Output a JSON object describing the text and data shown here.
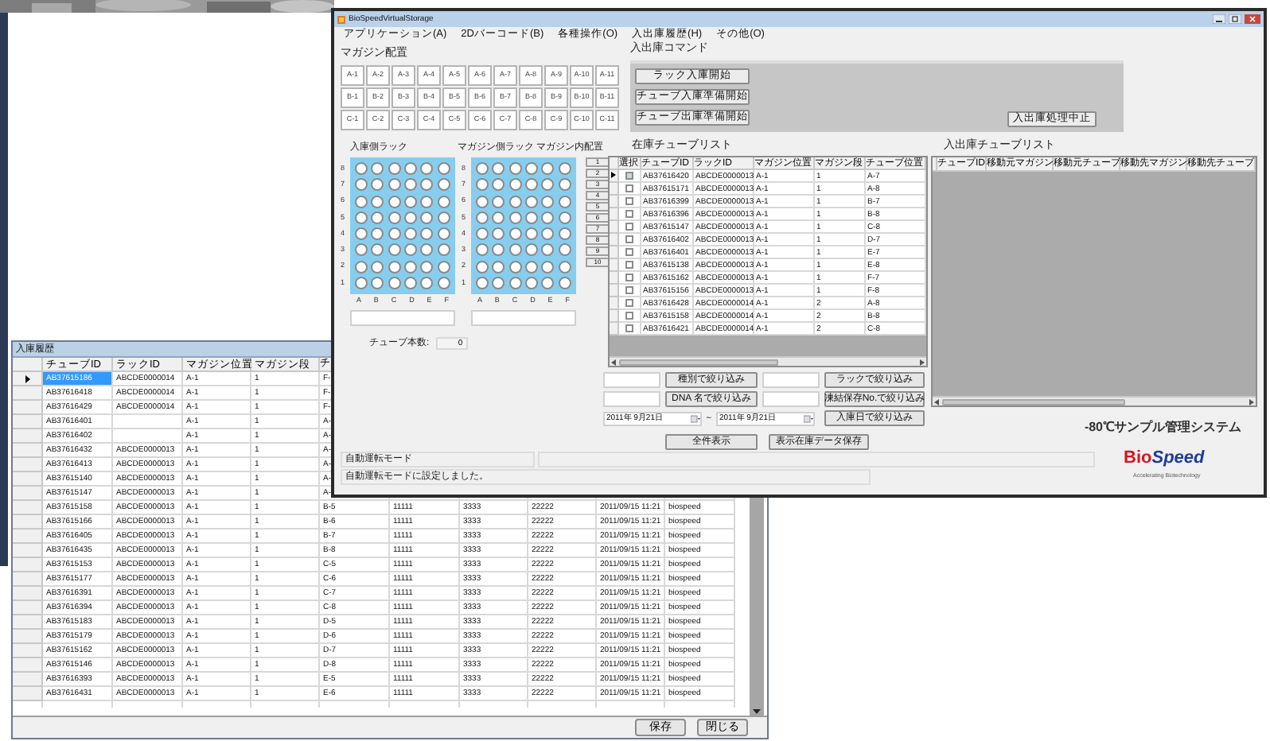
{
  "main_window": {
    "title": "BioSpeedVirtualStorage",
    "menu": [
      "アプリケーション(A)",
      "2Dバーコード(B)",
      "各種操作(O)",
      "入出庫履歴(H)",
      "その他(O)"
    ],
    "magazine_layout": {
      "label": "マガジン配置",
      "rows": [
        [
          "A-1",
          "A-2",
          "A-3",
          "A-4",
          "A-5",
          "A-6",
          "A-7",
          "A-8",
          "A-9",
          "A-10",
          "A-11"
        ],
        [
          "B-1",
          "B-2",
          "B-3",
          "B-4",
          "B-5",
          "B-6",
          "B-7",
          "B-8",
          "B-9",
          "B-10",
          "B-11"
        ],
        [
          "C-1",
          "C-2",
          "C-3",
          "C-4",
          "C-5",
          "C-6",
          "C-7",
          "C-8",
          "C-9",
          "C-10",
          "C-11"
        ]
      ]
    },
    "commands": {
      "label": "入出庫コマンド",
      "buttons": [
        "ラック入庫開始",
        "チューブ入庫準備開始",
        "チューブ出庫準備開始"
      ],
      "stop_button": "入出庫処理中止"
    },
    "racks": [
      {
        "label": "入庫側ラック",
        "row_labels": [
          "8",
          "7",
          "6",
          "5",
          "4",
          "3",
          "2",
          "1"
        ],
        "column_labels": [
          "A",
          "B",
          "C",
          "D",
          "E",
          "F"
        ]
      },
      {
        "label": "マガジン側ラック",
        "row_labels": [
          "8",
          "7",
          "6",
          "5",
          "4",
          "3",
          "2",
          "1"
        ],
        "column_labels": [
          "A",
          "B",
          "C",
          "D",
          "E",
          "F"
        ]
      }
    ],
    "magazine_positions": {
      "label": "マガジン内配置",
      "buttons": [
        "1",
        "2",
        "3",
        "4",
        "5",
        "6",
        "7",
        "8",
        "9",
        "10"
      ]
    },
    "tube_count": {
      "label": "チューブ本数:",
      "value": "0"
    },
    "stock_list": {
      "label": "在庫チューブリスト",
      "select_column": "選択",
      "columns": [
        "チューブID",
        "ラックID",
        "マガジン位置",
        "マガジン段",
        "チューブ位置"
      ],
      "rows": [
        {
          "selected": true,
          "checked": false,
          "cells": [
            "AB37616420",
            "ABCDE0000013",
            "A-1",
            "1",
            "A-7"
          ]
        },
        {
          "selected": false,
          "checked": false,
          "cells": [
            "AB37615171",
            "ABCDE0000013",
            "A-1",
            "1",
            "A-8"
          ]
        },
        {
          "selected": false,
          "checked": false,
          "cells": [
            "AB37616399",
            "ABCDE0000013",
            "A-1",
            "1",
            "B-7"
          ]
        },
        {
          "selected": false,
          "checked": false,
          "cells": [
            "AB37616396",
            "ABCDE0000013",
            "A-1",
            "1",
            "B-8"
          ]
        },
        {
          "selected": false,
          "checked": false,
          "cells": [
            "AB37615147",
            "ABCDE0000013",
            "A-1",
            "1",
            "C-8"
          ]
        },
        {
          "selected": false,
          "checked": false,
          "cells": [
            "AB37616402",
            "ABCDE0000013",
            "A-1",
            "1",
            "D-7"
          ]
        },
        {
          "selected": false,
          "checked": false,
          "cells": [
            "AB37616401",
            "ABCDE0000013",
            "A-1",
            "1",
            "E-7"
          ]
        },
        {
          "selected": false,
          "checked": false,
          "cells": [
            "AB37615138",
            "ABCDE0000013",
            "A-1",
            "1",
            "E-8"
          ]
        },
        {
          "selected": false,
          "checked": false,
          "cells": [
            "AB37615162",
            "ABCDE0000013",
            "A-1",
            "1",
            "F-7"
          ]
        },
        {
          "selected": false,
          "checked": false,
          "cells": [
            "AB37615156",
            "ABCDE0000013",
            "A-1",
            "1",
            "F-8"
          ]
        },
        {
          "selected": false,
          "checked": false,
          "cells": [
            "AB37616428",
            "ABCDE0000014",
            "A-1",
            "2",
            "A-8"
          ]
        },
        {
          "selected": false,
          "checked": false,
          "cells": [
            "AB37615158",
            "ABCDE0000014",
            "A-1",
            "2",
            "B-8"
          ]
        },
        {
          "selected": false,
          "checked": false,
          "cells": [
            "AB37616421",
            "ABCDE0000014",
            "A-1",
            "2",
            "C-8"
          ]
        }
      ]
    },
    "filters": {
      "type_button": "種別で絞り込み",
      "rack_button": "ラックで絞り込み",
      "dna_button": "DNA 名で絞り込み",
      "storage_button": "凍結保存No.で絞り込み",
      "date_from": "2011年 9月21日",
      "date_separator": "～",
      "date_to": "2011年 9月21日",
      "date_button": "入庫日で絞り込み",
      "show_all_button": "全件表示",
      "save_button": "表示在庫データ保存"
    },
    "transfer_list": {
      "label": "入出庫チューブリスト",
      "columns": [
        "チューブID",
        "移動元マガジン",
        "移動元チューブ",
        "移動先マガジン",
        "移動先チューブ"
      ]
    },
    "system_name": "-80℃サンプル管理システム",
    "logo": [
      "Bio",
      "Speed"
    ],
    "tagline": "Accelerating Biotechnology",
    "status": {
      "mode": "自動運転モード",
      "message": "自動運転モードに設定しました。"
    }
  },
  "history_window": {
    "title": "入庫履歴",
    "columns": [
      "チューブID",
      "ラックID",
      "マガジン位置",
      "マガジン段",
      "チ"
    ],
    "rows": [
      {
        "selected": true,
        "tube_id": "AB37615186",
        "rack_id": "ABCDE0000014",
        "magazine_position": "A-1",
        "magazine_stage": "1",
        "tube_position": "F-"
      },
      {
        "selected": false,
        "tube_id": "AB37616418",
        "rack_id": "ABCDE0000014",
        "magazine_position": "A-1",
        "magazine_stage": "1",
        "tube_position": "F-"
      },
      {
        "selected": false,
        "tube_id": "AB37616429",
        "rack_id": "ABCDE0000014",
        "magazine_position": "A-1",
        "magazine_stage": "1",
        "tube_position": "F-"
      },
      {
        "selected": false,
        "tube_id": "AB37616401",
        "magazine_position": "A-1",
        "magazine_stage": "1",
        "tube_position": "A-"
      },
      {
        "selected": false,
        "tube_id": "AB37616402",
        "magazine_position": "A-1",
        "magazine_stage": "1",
        "tube_position": "A-"
      },
      {
        "selected": false,
        "tube_id": "AB37616432",
        "rack_id": "ABCDE0000013",
        "magazine_position": "A-1",
        "magazine_stage": "1",
        "tube_position": "A-"
      },
      {
        "selected": false,
        "tube_id": "AB37616413",
        "rack_id": "ABCDE0000013",
        "magazine_position": "A-1",
        "magazine_stage": "1",
        "tube_position": "A-"
      },
      {
        "selected": false,
        "tube_id": "AB37615140",
        "rack_id": "ABCDE0000013",
        "magazine_position": "A-1",
        "magazine_stage": "1",
        "tube_position": "A-"
      },
      {
        "selected": false,
        "tube_id": "AB37615147",
        "rack_id": "ABCDE0000013",
        "magazine_position": "A-1",
        "magazine_stage": "1",
        "tube_position": "A-"
      },
      {
        "selected": false,
        "tube_id": "AB37615158",
        "rack_id": "ABCDE0000013",
        "magazine_position": "A-1",
        "magazine_stage": "1",
        "tube_position": "B-5",
        "column_6": "11111",
        "column_7": "3333",
        "column_8": "22222",
        "column_9": "2011/09/15 11:21",
        "column_10": "biospeed"
      },
      {
        "selected": false,
        "tube_id": "AB37615166",
        "rack_id": "ABCDE0000013",
        "magazine_position": "A-1",
        "magazine_stage": "1",
        "tube_position": "B-6",
        "column_6": "11111",
        "column_7": "3333",
        "column_8": "22222",
        "column_9": "2011/09/15 11:21",
        "column_10": "biospeed"
      },
      {
        "selected": false,
        "tube_id": "AB37616405",
        "rack_id": "ABCDE0000013",
        "magazine_position": "A-1",
        "magazine_stage": "1",
        "tube_position": "B-7",
        "column_6": "11111",
        "column_7": "3333",
        "column_8": "22222",
        "column_9": "2011/09/15 11:21",
        "column_10": "biospeed"
      },
      {
        "selected": false,
        "tube_id": "AB37616435",
        "rack_id": "ABCDE0000013",
        "magazine_position": "A-1",
        "magazine_stage": "1",
        "tube_position": "B-8",
        "column_6": "11111",
        "column_7": "3333",
        "column_8": "22222",
        "column_9": "2011/09/15 11:21",
        "column_10": "biospeed"
      },
      {
        "selected": false,
        "tube_id": "AB37615153",
        "rack_id": "ABCDE0000013",
        "magazine_position": "A-1",
        "magazine_stage": "1",
        "tube_position": "C-5",
        "column_6": "11111",
        "column_7": "3333",
        "column_8": "22222",
        "column_9": "2011/09/15 11:21",
        "column_10": "biospeed"
      },
      {
        "selected": false,
        "tube_id": "AB37615177",
        "rack_id": "ABCDE0000013",
        "magazine_position": "A-1",
        "magazine_stage": "1",
        "tube_position": "C-6",
        "column_6": "11111",
        "column_7": "3333",
        "column_8": "22222",
        "column_9": "2011/09/15 11:21",
        "column_10": "biospeed"
      },
      {
        "selected": false,
        "tube_id": "AB37616391",
        "rack_id": "ABCDE0000013",
        "magazine_position": "A-1",
        "magazine_stage": "1",
        "tube_position": "C-7",
        "column_6": "11111",
        "column_7": "3333",
        "column_8": "22222",
        "column_9": "2011/09/15 11:21",
        "column_10": "biospeed"
      },
      {
        "selected": false,
        "tube_id": "AB37616394",
        "rack_id": "ABCDE0000013",
        "magazine_position": "A-1",
        "magazine_stage": "1",
        "tube_position": "C-8",
        "column_6": "11111",
        "column_7": "3333",
        "column_8": "22222",
        "column_9": "2011/09/15 11:21",
        "column_10": "biospeed"
      },
      {
        "selected": false,
        "tube_id": "AB37615183",
        "rack_id": "ABCDE0000013",
        "magazine_position": "A-1",
        "magazine_stage": "1",
        "tube_position": "D-5",
        "column_6": "11111",
        "column_7": "3333",
        "column_8": "22222",
        "column_9": "2011/09/15 11:21",
        "column_10": "biospeed"
      },
      {
        "selected": false,
        "tube_id": "AB37615179",
        "rack_id": "ABCDE0000013",
        "magazine_position": "A-1",
        "magazine_stage": "1",
        "tube_position": "D-6",
        "column_6": "11111",
        "column_7": "3333",
        "column_8": "22222",
        "column_9": "2011/09/15 11:21",
        "column_10": "biospeed"
      },
      {
        "selected": false,
        "tube_id": "AB37615162",
        "rack_id": "ABCDE0000013",
        "magazine_position": "A-1",
        "magazine_stage": "1",
        "tube_position": "D-7",
        "column_6": "11111",
        "column_7": "3333",
        "column_8": "22222",
        "column_9": "2011/09/15 11:21",
        "column_10": "biospeed"
      },
      {
        "selected": false,
        "tube_id": "AB37615146",
        "rack_id": "ABCDE0000013",
        "magazine_position": "A-1",
        "magazine_stage": "1",
        "tube_position": "D-8",
        "column_6": "11111",
        "column_7": "3333",
        "column_8": "22222",
        "column_9": "2011/09/15 11:21",
        "column_10": "biospeed"
      },
      {
        "selected": false,
        "tube_id": "AB37616393",
        "rack_id": "ABCDE0000013",
        "magazine_position": "A-1",
        "magazine_stage": "1",
        "tube_position": "E-5",
        "column_6": "11111",
        "column_7": "3333",
        "column_8": "22222",
        "column_9": "2011/09/15 11:21",
        "column_10": "biospeed"
      },
      {
        "selected": false,
        "tube_id": "AB37616431",
        "rack_id": "ABCDE0000013",
        "magazine_position": "A-1",
        "magazine_stage": "1",
        "tube_position": "E-6",
        "column_6": "11111",
        "column_7": "3333",
        "column_8": "22222",
        "column_9": "2011/09/15 11:21",
        "column_10": "biospeed"
      }
    ],
    "buttons": [
      "保存",
      "閉じる"
    ]
  }
}
